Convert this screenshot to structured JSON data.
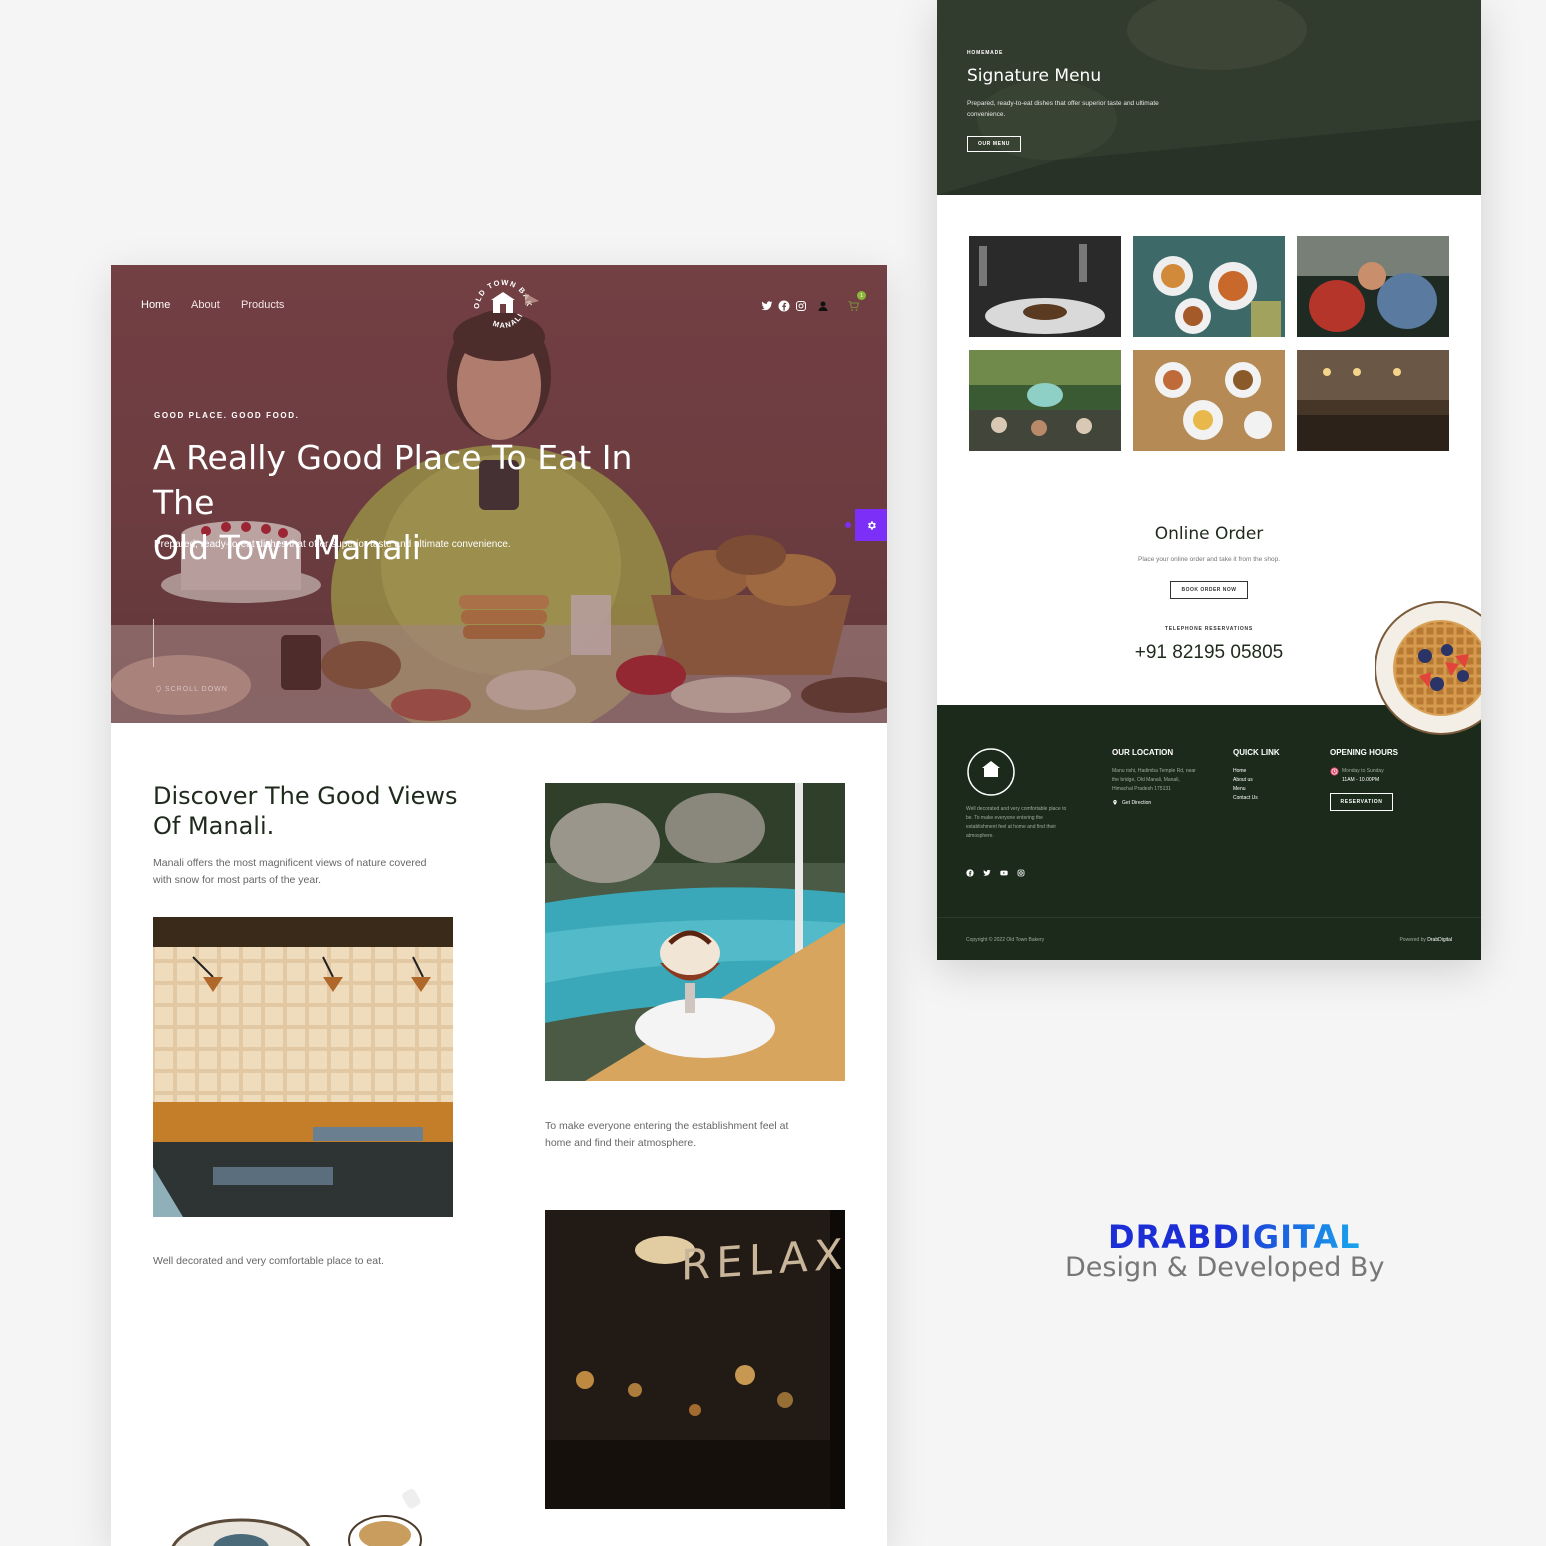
{
  "left": {
    "nav": {
      "home": "Home",
      "about": "About",
      "products": "Products",
      "cart_count": "1"
    },
    "logo": {
      "top": "OLD TOWN BAKERY",
      "bottom": "MANALI"
    },
    "hero": {
      "kicker": "GOOD PLACE. GOOD FOOD.",
      "title_line1": "A Really Good Place To Eat In The",
      "title_line2": "Old Town Manali",
      "subtitle": "Prepared, ready-to-eat dishes that offer superior taste and ultimate convenience.",
      "scroll": "SCROLL DOWN"
    },
    "discover": {
      "title_line1": "Discover The Good Views",
      "title_line2": "Of Manali.",
      "text_line1": "Manali offers the most magnificent views of nature covered",
      "text_line2": "with snow for most parts of the year.",
      "caption_right_line1": "To make everyone entering the establishment feel at",
      "caption_right_line2": "home and find their atmosphere.",
      "caption_left": "Well decorated and very comfortable place to eat.",
      "relax_sign": "RELAX"
    }
  },
  "right": {
    "signature": {
      "kicker": "HOMEMADE",
      "title": "Signature Menu",
      "text_line1": "Prepared, ready-to-eat dishes that offer superior taste and ultimate",
      "text_line2": "convenience.",
      "button": "OUR MENU"
    },
    "order": {
      "title": "Online Order",
      "text": "Place your online order and take it from the shop.",
      "button": "BOOK ORDER NOW",
      "tel_label": "TELEPHONE RESERVATIONS",
      "phone": "+91 82195 05805"
    },
    "footer": {
      "about_line1": "Well decorated and very comfortable place to",
      "about_line2": "be. To make everyone entering the",
      "about_line3": "establishment feel at home and find their",
      "about_line4": "atmosphere.",
      "location_title": "OUR LOCATION",
      "location_line1": "Manu rishi, Hadimba Temple Rd, near",
      "location_line2": "the bridge, Old Manali, Manali,",
      "location_line3": "Himachal Pradesh 175131",
      "direction": "Get Direction",
      "quick_title": "QUICK LINK",
      "quick_links": [
        "Home",
        "About us",
        "Menu",
        "Contact Us"
      ],
      "hours_title": "OPENING HOURS",
      "days": "Monday to Sunday",
      "hours": "11AM - 10.00PM",
      "reservation": "RESERVATION",
      "copyright": "Copyright © 2022 Old Town Bakery",
      "powered_prefix": "Powered by ",
      "powered_brand": "DrabDigital"
    }
  },
  "credit": {
    "brand": "DRABDIGITAL",
    "tagline": "Design & Developed By"
  },
  "colors": {
    "hero_overlay": "#7a4548",
    "footer_bg": "#1b2a1a",
    "accent_purple": "#7b2ff7",
    "brand_blue": "#1c2fd6",
    "brand_cyan": "#19a6ec"
  },
  "icons": [
    "twitter-icon",
    "facebook-icon",
    "instagram-icon",
    "user-icon",
    "cart-icon",
    "settings-gear-icon",
    "location-pin-icon",
    "clock-icon",
    "youtube-icon"
  ]
}
